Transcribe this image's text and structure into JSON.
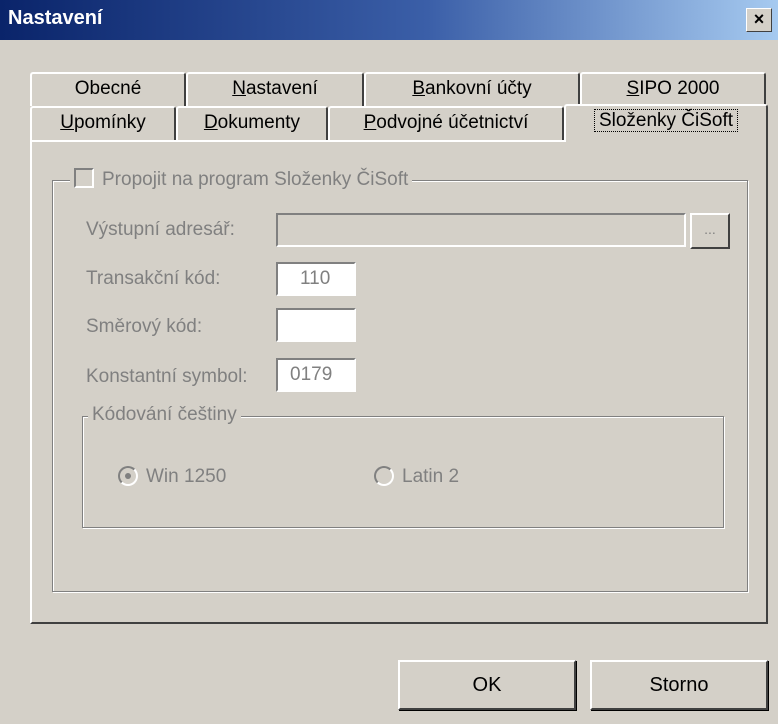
{
  "window": {
    "title": "Nastavení",
    "close_symbol": "×",
    "close_icon": "close-icon"
  },
  "tabs": {
    "row1": [
      {
        "pre": "Obecné",
        "ul": "",
        "post": ""
      },
      {
        "pre": "",
        "ul": "N",
        "post": "astavení"
      },
      {
        "pre": "",
        "ul": "B",
        "post": "ankovní účty"
      },
      {
        "pre": "",
        "ul": "S",
        "post": "IPO 2000"
      }
    ],
    "row2": [
      {
        "pre": "",
        "ul": "U",
        "post": "pomínky"
      },
      {
        "pre": "",
        "ul": "D",
        "post": "okumenty"
      },
      {
        "pre": "",
        "ul": "P",
        "post": "odvojné účetnictví"
      },
      {
        "pre": "Složenky ČiSoft",
        "ul": "",
        "post": ""
      }
    ],
    "active": "Složenky ČiSoft"
  },
  "cisoft": {
    "link_label": "Propojit na program Složenky ČiSoft",
    "link_checked": false,
    "output_dir_label": "Výstupní adresář:",
    "output_dir_value": "",
    "browse_label": "...",
    "transaction_code_label": "Transakční kód:",
    "transaction_code_value": "110",
    "direction_code_label": "Směrový kód:",
    "direction_code_value": "",
    "constant_symbol_label": "Konstantní symbol:",
    "constant_symbol_value": "0179",
    "encoding_group_label": "Kódování češtiny",
    "encoding_options": [
      "Win 1250",
      "Latin 2"
    ],
    "encoding_selected": "Win 1250"
  },
  "buttons": {
    "ok": "OK",
    "cancel": "Storno"
  },
  "colors": {
    "title_start": "#0a246a",
    "title_end": "#a6caf0",
    "face": "#d4d0c8",
    "disabled_text": "#808080"
  }
}
